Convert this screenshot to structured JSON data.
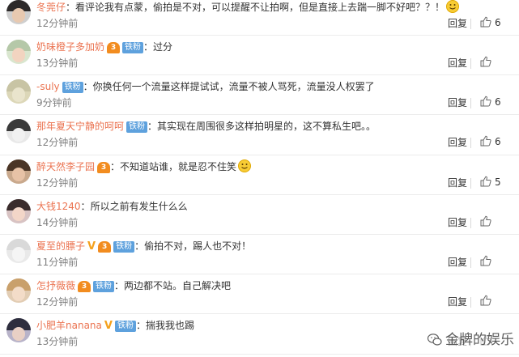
{
  "comments": [
    {
      "username": "冬莞仔",
      "vip": false,
      "v": false,
      "fan": "",
      "text": "看评论我有点蒙，偷拍是不对，可以提醒不让拍啊，但是直接上去踹一脚不好吧？？！",
      "time": "12分钟前",
      "reply": "回复",
      "likes": "6",
      "emoji": true,
      "avatar": {
        "hair": "#2d2a2a",
        "face": "#e8c9b0",
        "bg": "#cfcfcf"
      }
    },
    {
      "username": "奶味橙子多加奶",
      "vip": true,
      "vip_label": "3",
      "v": false,
      "fan": "铁粉",
      "text": "过分",
      "time": "13分钟前",
      "reply": "回复",
      "likes": "",
      "emoji": false,
      "avatar": {
        "hair": "#b5c8a8",
        "face": "#f2d4c0",
        "bg": "#d9e6cf"
      }
    },
    {
      "username": "-suly",
      "vip": false,
      "v": false,
      "fan": "铁粉",
      "text": "你换任何一个流量这样提试试，流量不被人骂死，流量没人权罢了",
      "time": "9分钟前",
      "reply": "回复",
      "likes": "6",
      "emoji": false,
      "avatar": {
        "hair": "#c8c4a4",
        "face": "#e9e4cc",
        "bg": "#dcd7b8"
      }
    },
    {
      "username": "那年夏天宁静的呵呵",
      "vip": false,
      "v": false,
      "fan": "铁粉",
      "text": "其实现在周围很多这样拍明星的，这不算私生吧。。",
      "time": "12分钟前",
      "reply": "回复",
      "likes": "6",
      "emoji": false,
      "avatar": {
        "hair": "#3a3a3a",
        "face": "#f1f1f1",
        "bg": "#e8e8e8"
      }
    },
    {
      "username": "醉天然李子园",
      "vip": true,
      "vip_label": "3",
      "v": false,
      "fan": "",
      "text": "不知道站谁，就是忍不住笑",
      "time": "12分钟前",
      "reply": "回复",
      "likes": "5",
      "emoji": true,
      "avatar": {
        "hair": "#4a3526",
        "face": "#e7c2a6",
        "bg": "#c9a98d"
      }
    },
    {
      "username": "大钱1240",
      "vip": false,
      "v": false,
      "fan": "",
      "text": "所以之前有发生什么么",
      "time": "14分钟前",
      "reply": "回复",
      "likes": "",
      "emoji": false,
      "avatar": {
        "hair": "#3a2c2c",
        "face": "#f3d6c8",
        "bg": "#d8c3c3"
      }
    },
    {
      "username": "夏至的膘子",
      "vip": true,
      "vip_label": "3",
      "v": true,
      "fan": "铁粉",
      "text": "偷拍不对，踢人也不对！",
      "time": "11分钟前",
      "reply": "回复",
      "likes": "",
      "emoji": false,
      "avatar": {
        "hair": "#d9d9d9",
        "face": "#f5f5f5",
        "bg": "#e9e9e9"
      }
    },
    {
      "username": "怎抒薇薇",
      "vip": true,
      "vip_label": "3",
      "v": false,
      "fan": "铁粉",
      "text": "两边都不站。自己解决吧",
      "time": "12分钟前",
      "reply": "回复",
      "likes": "",
      "emoji": false,
      "avatar": {
        "hair": "#c9a06b",
        "face": "#f3dcc8",
        "bg": "#e2cdb4"
      }
    },
    {
      "username": "小肥羊nanana",
      "vip": false,
      "v": true,
      "fan": "铁粉",
      "text": "揣我我也踢",
      "time": "13分钟前",
      "reply": "回复",
      "likes": "",
      "emoji": false,
      "avatar": {
        "hair": "#2e2e3e",
        "face": "#e9d0c5",
        "bg": "#b8b3c9"
      }
    }
  ],
  "watermark": "金牌的娱乐",
  "colors": {
    "username": "#eb7350",
    "fan_badge": "#5ea1dd",
    "time": "#808080"
  }
}
